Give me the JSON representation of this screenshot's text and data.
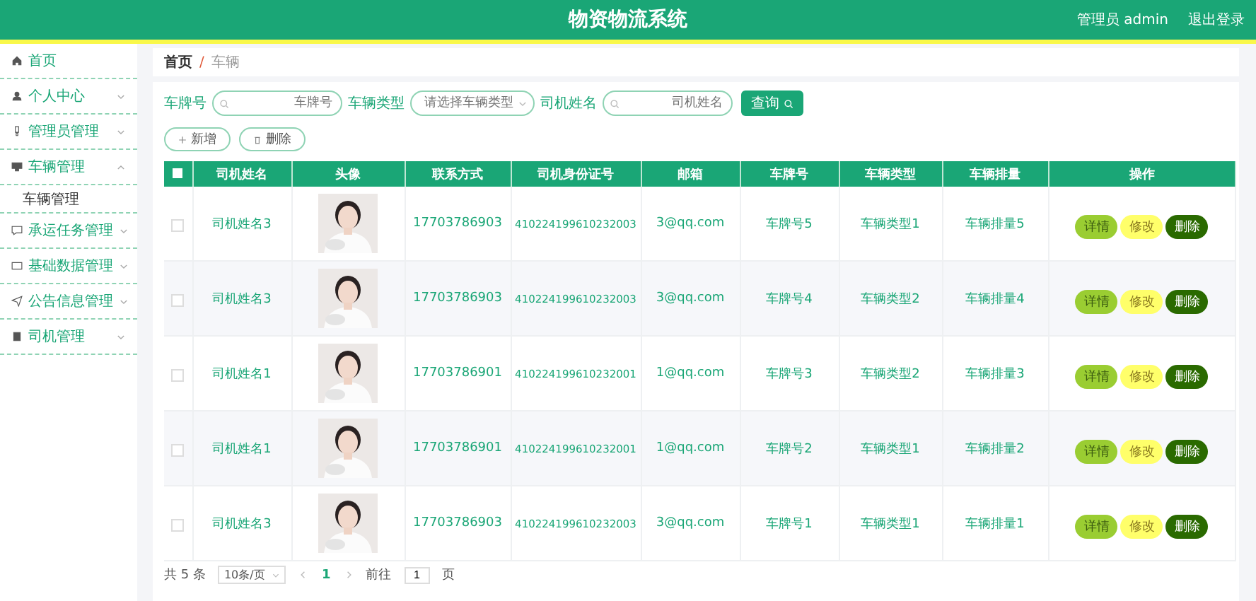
{
  "header": {
    "title": "物资物流系统",
    "user": "管理员 admin",
    "logout": "退出登录"
  },
  "sidebar": {
    "items": [
      {
        "label": "首页",
        "expanded": false,
        "has_children": false
      },
      {
        "label": "个人中心",
        "expanded": false,
        "has_children": true
      },
      {
        "label": "管理员管理",
        "expanded": false,
        "has_children": true
      },
      {
        "label": "车辆管理",
        "expanded": true,
        "has_children": true,
        "children": [
          {
            "label": "车辆管理"
          }
        ]
      },
      {
        "label": "承运任务管理",
        "expanded": false,
        "has_children": true
      },
      {
        "label": "基础数据管理",
        "expanded": false,
        "has_children": true
      },
      {
        "label": "公告信息管理",
        "expanded": false,
        "has_children": true
      },
      {
        "label": "司机管理",
        "expanded": false,
        "has_children": true
      }
    ]
  },
  "breadcrumb": {
    "separator": "/",
    "items": [
      "首页",
      "车辆"
    ]
  },
  "filters": [
    {
      "kind": "input",
      "label": "车牌号",
      "placeholder": "车牌号"
    },
    {
      "kind": "select",
      "label": "车辆类型",
      "placeholder": "请选择车辆类型"
    },
    {
      "kind": "input",
      "label": "司机姓名",
      "placeholder": "司机姓名"
    }
  ],
  "search_button": "查询",
  "toolbar": [
    {
      "kind": "add",
      "label": "新增"
    },
    {
      "kind": "delete",
      "label": "删除"
    }
  ],
  "table": {
    "select_all_checked": false,
    "columns": [
      "司机姓名",
      "头像",
      "联系方式",
      "司机身份证号",
      "邮箱",
      "车牌号",
      "车辆类型",
      "车辆排量",
      "操作"
    ],
    "rows": [
      {
        "checked": false,
        "name": "司机姓名3",
        "phone": "17703786903",
        "id_no": "410224199610232003",
        "email": "3@qq.com",
        "plate": "车牌号5",
        "type": "车辆类型1",
        "displacement": "车辆排量5",
        "actions": [
          {
            "kind": "detail",
            "label": "详情"
          },
          {
            "kind": "edit",
            "label": "修改"
          },
          {
            "kind": "delete",
            "label": "删除"
          }
        ]
      },
      {
        "checked": false,
        "name": "司机姓名3",
        "phone": "17703786903",
        "id_no": "410224199610232003",
        "email": "3@qq.com",
        "plate": "车牌号4",
        "type": "车辆类型2",
        "displacement": "车辆排量4",
        "actions": [
          {
            "kind": "detail",
            "label": "详情"
          },
          {
            "kind": "edit",
            "label": "修改"
          },
          {
            "kind": "delete",
            "label": "删除"
          }
        ]
      },
      {
        "checked": false,
        "name": "司机姓名1",
        "phone": "17703786901",
        "id_no": "410224199610232001",
        "email": "1@qq.com",
        "plate": "车牌号3",
        "type": "车辆类型2",
        "displacement": "车辆排量3",
        "actions": [
          {
            "kind": "detail",
            "label": "详情"
          },
          {
            "kind": "edit",
            "label": "修改"
          },
          {
            "kind": "delete",
            "label": "删除"
          }
        ]
      },
      {
        "checked": false,
        "name": "司机姓名1",
        "phone": "17703786901",
        "id_no": "410224199610232001",
        "email": "1@qq.com",
        "plate": "车牌号2",
        "type": "车辆类型1",
        "displacement": "车辆排量2",
        "actions": [
          {
            "kind": "detail",
            "label": "详情"
          },
          {
            "kind": "edit",
            "label": "修改"
          },
          {
            "kind": "delete",
            "label": "删除"
          }
        ]
      },
      {
        "checked": false,
        "name": "司机姓名3",
        "phone": "17703786903",
        "id_no": "410224199610232003",
        "email": "3@qq.com",
        "plate": "车牌号1",
        "type": "车辆类型1",
        "displacement": "车辆排量1",
        "actions": [
          {
            "kind": "detail",
            "label": "详情"
          },
          {
            "kind": "edit",
            "label": "修改"
          },
          {
            "kind": "delete",
            "label": "删除"
          }
        ]
      }
    ]
  },
  "pagination": {
    "total": "共 5 条",
    "page_size": "10条/页",
    "pages": [
      {
        "label": "1",
        "selected": true
      }
    ],
    "goto_label": "前往",
    "goto_value": "1",
    "goto_suffix": "页"
  }
}
